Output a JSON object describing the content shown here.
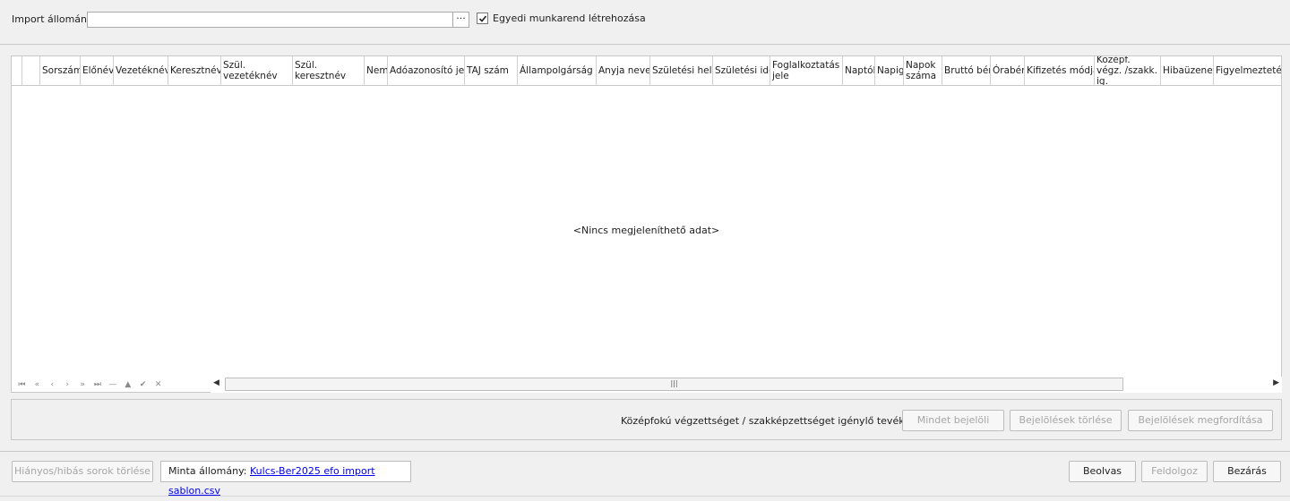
{
  "import": {
    "label": "Import állomány",
    "value": "",
    "browse_label": "···",
    "checkbox_label": "Egyedi munkarend létrehozása",
    "checkbox_checked": true
  },
  "grid": {
    "columns": [
      "Sorszám",
      "Előnév",
      "Vezetéknév",
      "Keresztnév",
      "Szül. vezetéknév",
      "Szül. keresztnév",
      "Nem",
      "Adóazonosító jel",
      "TAJ szám",
      "Állampolgárság",
      "Anyja neve",
      "Születési hely",
      "Születési idő",
      "Foglalkoztatás jele",
      "Naptól",
      "Napig",
      "Napok száma",
      "Bruttó bér",
      "Órabér",
      "Kifizetés módja",
      "Középf. végz. /szakk. ig.",
      "Hibaüzenet",
      "Figyelmeztetés"
    ],
    "empty_text": "<Nincs megjeleníthető adat>",
    "navigator": [
      "⏮",
      "«",
      "‹",
      "›",
      "»",
      "⏭",
      "—",
      "▲",
      "✔",
      "✕"
    ],
    "scroll_thumb": "|||",
    "scroll_left": "◀",
    "scroll_right": "▶"
  },
  "section": {
    "label": "Középfokú végzettséget / szakképzettséget igénylő tevékenység",
    "buttons": {
      "select_all": "Mindet bejelöli",
      "clear": "Bejelölések törlése",
      "invert": "Bejelölések megfordítása"
    }
  },
  "footer": {
    "delete_rows": "Hiányos/hibás sorok törlése",
    "minta_label": "Minta állomány:",
    "minta_link": "Kulcs-Ber2025 efo import sablon.csv",
    "read": "Beolvas",
    "process": "Feldolgoz",
    "close": "Bezárás"
  }
}
